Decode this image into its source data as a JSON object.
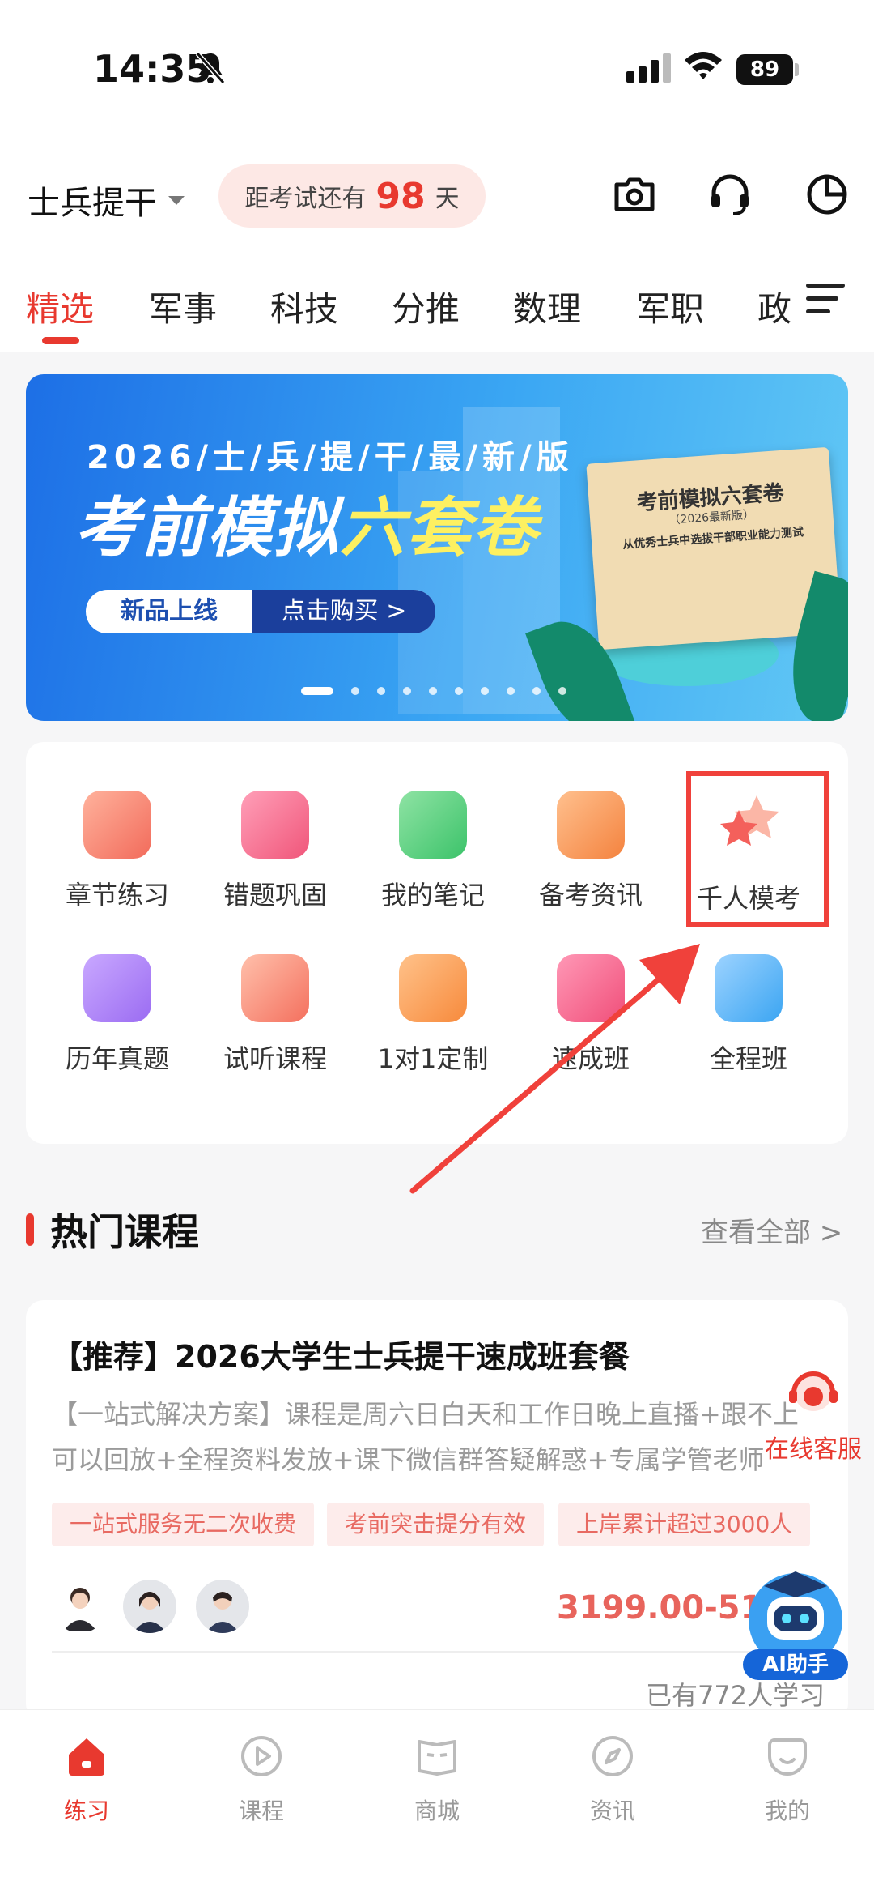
{
  "status": {
    "time": "14:35",
    "battery": "89"
  },
  "header": {
    "exam_type": "士兵提干",
    "countdown_prefix": "距考试还有",
    "countdown_days": "98",
    "countdown_suffix": "天",
    "icons": [
      "camera-icon",
      "headset-icon",
      "pie-chart-icon"
    ]
  },
  "tabs": [
    "精选",
    "军事",
    "科技",
    "分推",
    "数理",
    "军职",
    "政"
  ],
  "active_tab": "精选",
  "banner": {
    "line1": "2026/士/兵/提/干/最/新/版",
    "title_white": "考前模拟",
    "title_yellow": "六套卷",
    "pill_left": "新品上线",
    "pill_right": "点击购买 >",
    "book_title": "考前模拟六套卷",
    "book_sub": "（2026最新版）",
    "book_sub2": "从优秀士兵中选拔干部职业能力测试",
    "slides": 10,
    "active_slide": 1
  },
  "features": [
    {
      "label": "章节练习",
      "icon": "chapter-icon",
      "color": "#f26b5b"
    },
    {
      "label": "错题巩固",
      "icon": "wrong-question-icon",
      "color": "#f0567a"
    },
    {
      "label": "我的笔记",
      "icon": "note-icon",
      "color": "#3cc36a"
    },
    {
      "label": "备考资讯",
      "icon": "news-icon",
      "color": "#f4833f"
    },
    {
      "label": "千人模考",
      "icon": "star-icon",
      "color": "#f4605b"
    },
    {
      "label": "历年真题",
      "icon": "past-papers-icon",
      "color": "#9b6cf2"
    },
    {
      "label": "试听课程",
      "icon": "trial-course-icon",
      "color": "#f4705e"
    },
    {
      "label": "1对1定制",
      "icon": "calendar-icon",
      "color": "#f78a3c"
    },
    {
      "label": "速成班",
      "icon": "crash-course-icon",
      "color": "#f04f7a"
    },
    {
      "label": "全程班",
      "icon": "full-course-icon",
      "color": "#3ba5f2"
    }
  ],
  "hot": {
    "title": "热门课程",
    "more": "查看全部 >"
  },
  "course": {
    "title": "【推荐】2026大学生士兵提干速成班套餐",
    "desc": "【一站式解决方案】课程是周六日白天和工作日晚上直播+跟不上可以回放+全程资料发放+课下微信群答疑解惑+专属学管老师",
    "tags": [
      "一站式服务无二次收费",
      "考前突击提分有效",
      "上岸累计超过3000人"
    ],
    "price": "3199.00-51",
    "learners": "已有772人学习"
  },
  "floating": {
    "service": "在线客服",
    "ai": "AI助手"
  },
  "nav": [
    "练习",
    "课程",
    "商城",
    "资讯",
    "我的"
  ],
  "colors": {
    "accent": "#e8392f",
    "highlight_box": "#f0413b"
  }
}
